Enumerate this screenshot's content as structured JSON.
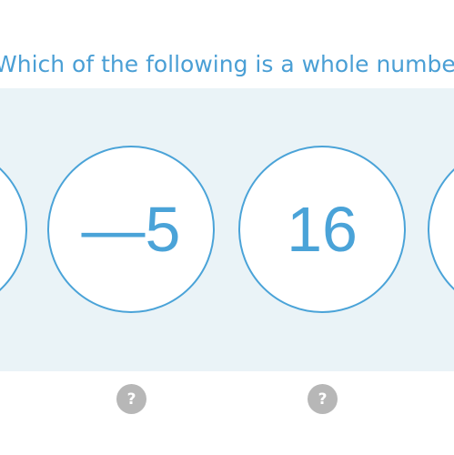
{
  "question": {
    "text": "Which of the following is a whole number?"
  },
  "choices": [
    {
      "label": ""
    },
    {
      "label": "—5"
    },
    {
      "label": "16"
    },
    {
      "label": ""
    }
  ],
  "hints": [
    {
      "icon": "question-icon",
      "label": "?"
    },
    {
      "icon": "question-icon",
      "label": "?"
    }
  ],
  "colors": {
    "accent": "#4aa3d8",
    "panel_background": "#eaf3f7",
    "hint_background": "#b7b7b7"
  }
}
